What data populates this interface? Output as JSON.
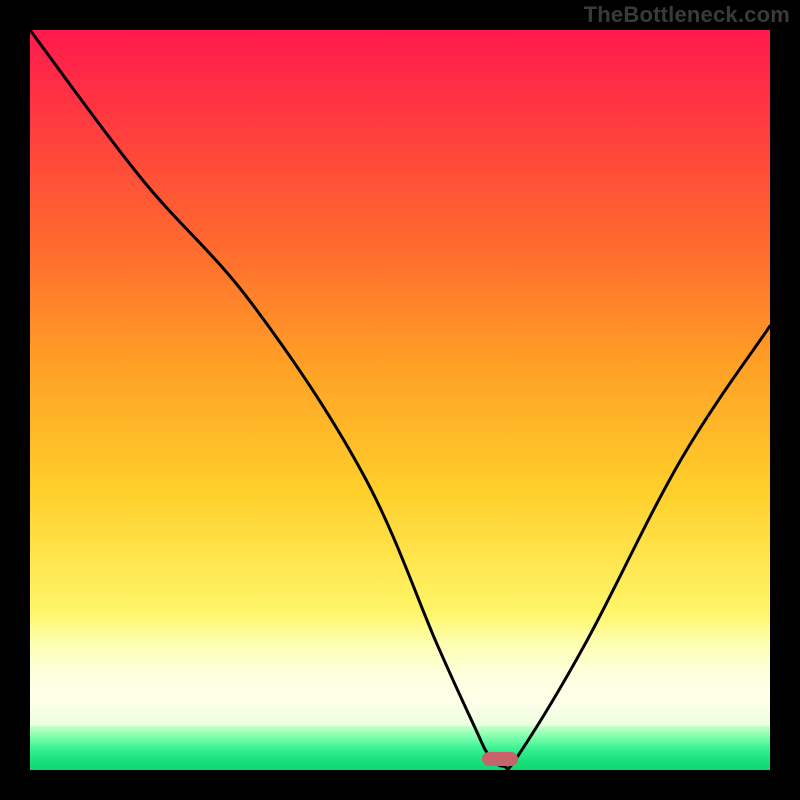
{
  "watermark": "TheBottleneck.com",
  "chart_data": {
    "type": "line",
    "title": "",
    "xlabel": "",
    "ylabel": "",
    "xlim": [
      0,
      100
    ],
    "ylim": [
      0,
      100
    ],
    "series": [
      {
        "name": "bottleneck-curve",
        "x": [
          0,
          15,
          30,
          45,
          55,
          60,
          62,
          64,
          66,
          75,
          88,
          100
        ],
        "values": [
          100,
          80,
          63,
          40,
          17,
          6,
          2,
          0.5,
          2,
          17,
          42,
          60
        ]
      }
    ],
    "marker": {
      "x": 63.5,
      "y": 1.5,
      "color": "#c6636b"
    },
    "bands": [
      {
        "name": "red-yellow-gradient",
        "y_from": 17,
        "y_to": 100
      },
      {
        "name": "pale-band",
        "y_from": 6,
        "y_to": 17
      },
      {
        "name": "green-band",
        "y_from": 0,
        "y_to": 6
      }
    ],
    "grid": false,
    "legend": false
  }
}
